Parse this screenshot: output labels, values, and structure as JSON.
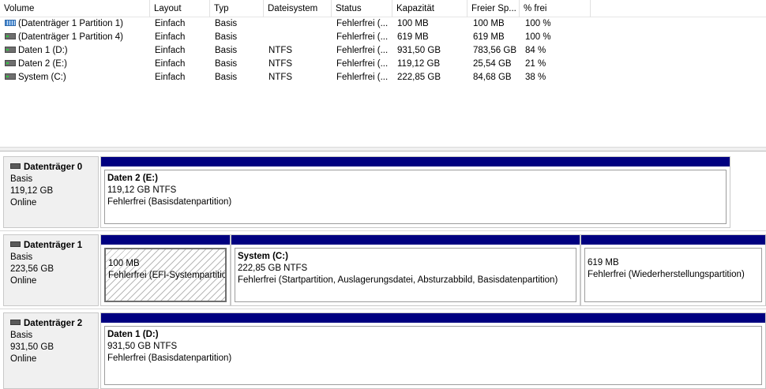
{
  "volume_list": {
    "columns": [
      "Volume",
      "Layout",
      "Typ",
      "Dateisystem",
      "Status",
      "Kapazität",
      "Freier Sp...",
      "% frei"
    ],
    "rows": [
      {
        "icon": "partition-striped-icon",
        "volume": "(Datenträger 1 Partition 1)",
        "layout": "Einfach",
        "typ": "Basis",
        "fs": "",
        "status": "Fehlerfrei (...",
        "capacity": "100 MB",
        "free": "100 MB",
        "pct": "100 %"
      },
      {
        "icon": "drive-icon",
        "volume": "(Datenträger 1 Partition 4)",
        "layout": "Einfach",
        "typ": "Basis",
        "fs": "",
        "status": "Fehlerfrei (...",
        "capacity": "619 MB",
        "free": "619 MB",
        "pct": "100 %"
      },
      {
        "icon": "drive-icon",
        "volume": "Daten 1 (D:)",
        "layout": "Einfach",
        "typ": "Basis",
        "fs": "NTFS",
        "status": "Fehlerfrei (...",
        "capacity": "931,50 GB",
        "free": "783,56 GB",
        "pct": "84 %"
      },
      {
        "icon": "drive-icon",
        "volume": "Daten 2 (E:)",
        "layout": "Einfach",
        "typ": "Basis",
        "fs": "NTFS",
        "status": "Fehlerfrei (...",
        "capacity": "119,12 GB",
        "free": "25,54 GB",
        "pct": "21 %"
      },
      {
        "icon": "drive-icon",
        "volume": "System (C:)",
        "layout": "Einfach",
        "typ": "Basis",
        "fs": "NTFS",
        "status": "Fehlerfrei (...",
        "capacity": "222,85 GB",
        "free": "84,68 GB",
        "pct": "38 %"
      }
    ]
  },
  "disks": [
    {
      "name": "Datenträger 0",
      "type": "Basis",
      "size": "119,12 GB",
      "state": "Online",
      "partitions": [
        {
          "title": "Daten 2  (E:)",
          "size": "119,12 GB NTFS",
          "status": "Fehlerfrei (Basisdatenpartition)",
          "hatched": false
        }
      ]
    },
    {
      "name": "Datenträger 1",
      "type": "Basis",
      "size": "223,56 GB",
      "state": "Online",
      "partitions": [
        {
          "title": "",
          "size": "100 MB",
          "status": "Fehlerfrei (EFI-Systempartition)",
          "hatched": true
        },
        {
          "title": "System  (C:)",
          "size": "222,85 GB NTFS",
          "status": "Fehlerfrei (Startpartition, Auslagerungsdatei, Absturzabbild, Basisdatenpartition)",
          "hatched": false
        },
        {
          "title": "",
          "size": "619 MB",
          "status": "Fehlerfrei (Wiederherstellungspartition)",
          "hatched": false
        }
      ]
    },
    {
      "name": "Datenträger 2",
      "type": "Basis",
      "size": "931,50 GB",
      "state": "Online",
      "partitions": [
        {
          "title": "Daten 1  (D:)",
          "size": "931,50 GB NTFS",
          "status": "Fehlerfrei (Basisdatenpartition)",
          "hatched": false
        }
      ]
    }
  ],
  "colors": {
    "partition_bar": "#000080",
    "info_bg": "#f0f0f0"
  }
}
